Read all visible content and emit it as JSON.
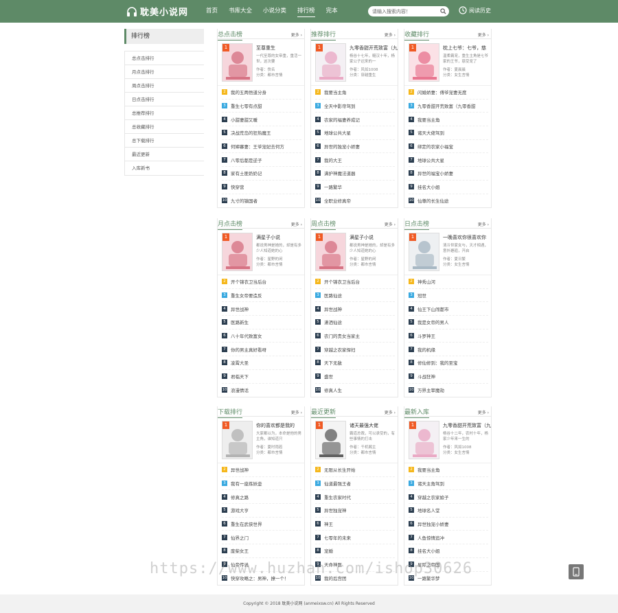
{
  "header": {
    "logo_text": "耽美小说网",
    "nav": [
      "首页",
      "书库大全",
      "小说分类",
      "排行榜",
      "完本"
    ],
    "search_placeholder": "请输入搜索内容！",
    "history_label": "阅读历史"
  },
  "colors": {
    "brand": "#5e8a67",
    "rank1": "#f05a24",
    "rank2": "#f5b71b",
    "rank3": "#39a9e0",
    "rank_other": "#2c3e50"
  },
  "sidebar": {
    "title": "排行榜",
    "items": [
      "总点击排行",
      "月点击排行",
      "周点击排行",
      "日点击排行",
      "总推荐排行",
      "总收藏排行",
      "总下载排行",
      "最近更新",
      "入库新书"
    ]
  },
  "more_label": "更多 ›",
  "boxes": [
    {
      "title": "总点击榜",
      "top": {
        "name": "至尊重生",
        "desc": "一代至尊的女帝重，重活一世，这次要",
        "author": "作者：佚名",
        "category": "分类：都市言情"
      },
      "rows": [
        "我的五两悟道分身",
        "重生七零有点甜",
        "小甜妻甜又暖",
        "决战荒岛的狂热魔王",
        "何婶寡妻：王爷宠妃去何方",
        "八零后都是逆子",
        "家有土匪奶奶记",
        "快穿营",
        "九寸的镇国者"
      ]
    },
    {
      "title": "推荐排行",
      "top": {
        "name": "九零香甜开荒致富（九",
        "desc": "杨谷十七年，糙汉十年，杨家公子迟来的一",
        "author": "作者：风如1008",
        "category": "分类：穿越重生"
      },
      "rows": [
        "我要当主角",
        "全天中影帝驾到",
        "农家的福妻养成记",
        "地球公共大星",
        "异世的独宠小娇妻",
        "我的大王",
        "满护神魔法道器",
        "一路繁华",
        "全职业修真帝"
      ]
    },
    {
      "title": "收藏排行",
      "top": {
        "name": "枕上七爷：七爷，慈",
        "desc": "温柔霸宠，重生主角是七爷家的王爷，慈受宠了",
        "author": "作者：夏晨晨",
        "category": "分类：女生言情"
      },
      "rows": [
        "闪婚娇妻：傅爷宠妻无度",
        "九零香甜开荒致富（九零香甜",
        "我要当主角",
        "诸天大佬驾到",
        "绑定的农家小福宝",
        "地球公共大星",
        "异世的福宝小娇妻",
        "挂名大小姐",
        "仙尊的长生仙途"
      ]
    },
    {
      "title": "月点击榜",
      "top": {
        "name": "满星子小说",
        "desc": "都说男神是她的，却是有多少人知道她的心",
        "author": "作者：星野的闲",
        "category": "分类：都市言情"
      },
      "rows": [
        "开个锦衣卫当后台",
        "重生女帝要造反",
        "异世战神",
        "医路新生",
        "八十年代致富女",
        "你的男主真好看呀",
        "凌霄大圣",
        "君临天下",
        "浪漫情话"
      ]
    },
    {
      "title": "周点击榜",
      "top": {
        "name": "满星子小说",
        "desc": "都说男神是她的，却是有多少人知道她的心",
        "author": "作者：星野的闲",
        "category": "分类：都市言情"
      },
      "rows": [
        "开个锦衣卫当后台",
        "医路仙途",
        "异世战神",
        "潇洒仙途",
        "农门的贵女当家主",
        "穿越之农家悍妇",
        "天下无敌",
        "盛世",
        "修真人生"
      ]
    },
    {
      "title": "日点击榜",
      "top": {
        "name": "一晚喜欢你很喜欢你",
        "desc": "清冷世家女与，天才相遇，意外邂逅，开启",
        "author": "作者：夏日繁",
        "category": "分类：女生言情"
      },
      "rows": [
        "神秀山河",
        "冠世",
        "仙王下山闯都市",
        "我是女帝的男人",
        "斗罗神王",
        "我的机缘",
        "修仙修到：我的至宝",
        "斗战狂神",
        "万界主宰魔劫"
      ]
    },
    {
      "title": "下载排行",
      "top": {
        "name": "你的喜欢都是我的",
        "desc": "大家都以为，本命是他的男主角，谁知道只",
        "author": "作者：夏时雨若",
        "category": "分类：都市言情"
      },
      "rows": [
        "异世战神",
        "我有一座炼妖壶",
        "修真之路",
        "游戏大亨",
        "重生在武侠世界",
        "仙界之门",
        "废柴女王",
        "仙帝传说",
        "快穿攻略之：男神，撩一个！"
      ]
    },
    {
      "title": "最近更新",
      "top": {
        "name": "诸天最强大佬",
        "desc": "霸道总裁，可以承受的，有些事情的打击",
        "author": "作者：千机阁主",
        "category": "分类：都市言情"
      },
      "rows": [
        "无限从长生开始",
        "仙道最强王者",
        "重生农家时代",
        "异世独宠神",
        "神王",
        "七零年的未来",
        "宠婚",
        "天命神医",
        "我的后宫团"
      ]
    },
    {
      "title": "最新入库",
      "top": {
        "name": "九零香甜开荒致富（九",
        "desc": "杨谷十二年，农村十年，杨家少年来一生的",
        "author": "作者：风如1008",
        "category": "分类：女生言情"
      },
      "rows": [
        "我要当主角",
        "诸天主角驾到",
        "穿越之农家娘子",
        "地球名人堂",
        "异世独宠小娇妻",
        "人鱼惊情追冲",
        "挂名大小姐",
        "星际之帝国",
        "一路繁华梦"
      ]
    }
  ],
  "footer": {
    "copyright": "Copyright © 2018 耽美小说网 (anmeixsw.cn) All Rights Reserved"
  },
  "watermark": "https://www.huzhan.com/ishop30626"
}
